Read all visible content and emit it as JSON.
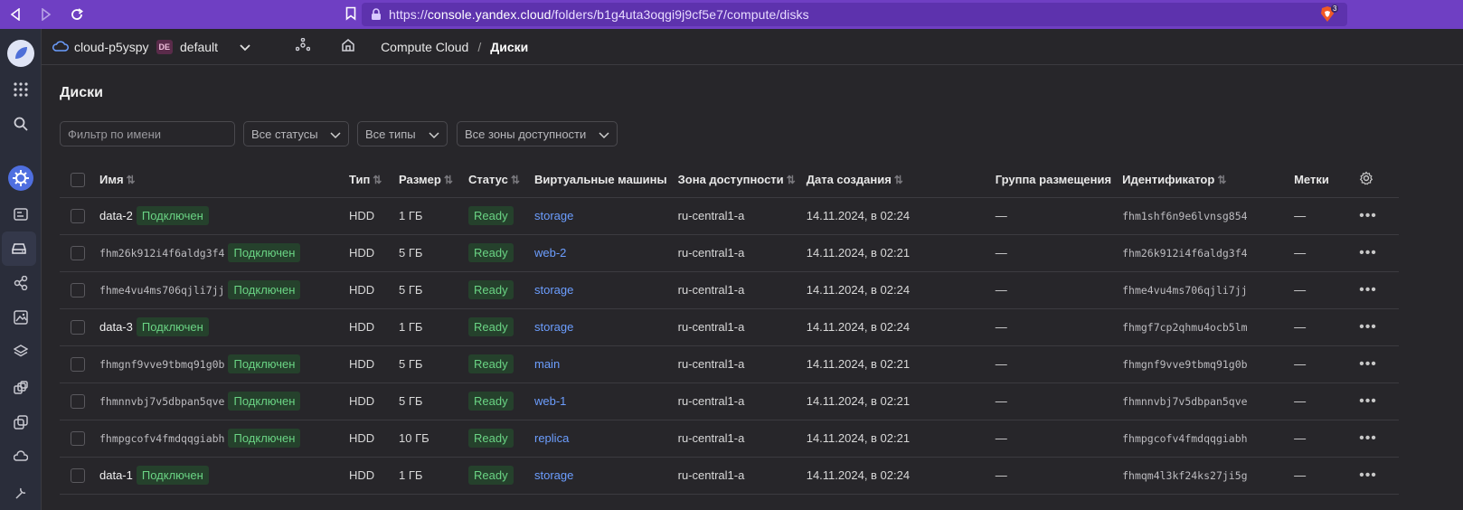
{
  "browser": {
    "url_prefix": "https://",
    "url_host": "console.yandex.cloud",
    "url_path": "/folders/b1g4uta3oqgi9j9cf5e7/compute/disks",
    "brave_badge": "3"
  },
  "topbar": {
    "cloud": "cloud-p5yspy",
    "folder_badge": "DE",
    "folder": "default",
    "breadcrumb_service": "Compute Cloud",
    "breadcrumb_sep": "/",
    "breadcrumb_current": "Диски"
  },
  "page": {
    "title": "Диски",
    "filter_placeholder": "Фильтр по имени",
    "status_select": "Все статусы",
    "type_select": "Все типы",
    "zone_select": "Все зоны доступности"
  },
  "table": {
    "headers": {
      "name": "Имя",
      "type": "Тип",
      "size": "Размер",
      "status": "Статус",
      "vms": "Виртуальные машины",
      "zone": "Зона доступности",
      "created": "Дата создания",
      "group": "Группа размещения",
      "id": "Идентификатор",
      "labels": "Метки"
    },
    "rows": [
      {
        "name": "data-2",
        "mono": false,
        "attached": "Подключен",
        "type": "HDD",
        "size": "1 ГБ",
        "status": "Ready",
        "vm": "storage",
        "zone": "ru-central1-a",
        "created": "14.11.2024, в 02:24",
        "group": "—",
        "id": "fhm1shf6n9e6lvnsg854",
        "labels": "—"
      },
      {
        "name": "fhm26k912i4f6aldg3f4",
        "mono": true,
        "attached": "Подключен",
        "type": "HDD",
        "size": "5 ГБ",
        "status": "Ready",
        "vm": "web-2",
        "zone": "ru-central1-a",
        "created": "14.11.2024, в 02:21",
        "group": "—",
        "id": "fhm26k912i4f6aldg3f4",
        "labels": "—"
      },
      {
        "name": "fhme4vu4ms706qjli7jj",
        "mono": true,
        "attached": "Подключен",
        "type": "HDD",
        "size": "5 ГБ",
        "status": "Ready",
        "vm": "storage",
        "zone": "ru-central1-a",
        "created": "14.11.2024, в 02:24",
        "group": "—",
        "id": "fhme4vu4ms706qjli7jj",
        "labels": "—"
      },
      {
        "name": "data-3",
        "mono": false,
        "attached": "Подключен",
        "type": "HDD",
        "size": "1 ГБ",
        "status": "Ready",
        "vm": "storage",
        "zone": "ru-central1-a",
        "created": "14.11.2024, в 02:24",
        "group": "—",
        "id": "fhmgf7cp2qhmu4ocb5lm",
        "labels": "—"
      },
      {
        "name": "fhmgnf9vve9tbmq91g0b",
        "mono": true,
        "attached": "Подключен",
        "type": "HDD",
        "size": "5 ГБ",
        "status": "Ready",
        "vm": "main",
        "zone": "ru-central1-a",
        "created": "14.11.2024, в 02:21",
        "group": "—",
        "id": "fhmgnf9vve9tbmq91g0b",
        "labels": "—"
      },
      {
        "name": "fhmnnvbj7v5dbpan5qve",
        "mono": true,
        "attached": "Подключен",
        "type": "HDD",
        "size": "5 ГБ",
        "status": "Ready",
        "vm": "web-1",
        "zone": "ru-central1-a",
        "created": "14.11.2024, в 02:21",
        "group": "—",
        "id": "fhmnnvbj7v5dbpan5qve",
        "labels": "—"
      },
      {
        "name": "fhmpgcofv4fmdqqgiabh",
        "mono": true,
        "attached": "Подключен",
        "type": "HDD",
        "size": "10 ГБ",
        "status": "Ready",
        "vm": "replica",
        "zone": "ru-central1-a",
        "created": "14.11.2024, в 02:21",
        "group": "—",
        "id": "fhmpgcofv4fmdqqgiabh",
        "labels": "—"
      },
      {
        "name": "data-1",
        "mono": false,
        "attached": "Подключен",
        "type": "HDD",
        "size": "1 ГБ",
        "status": "Ready",
        "vm": "storage",
        "zone": "ru-central1-a",
        "created": "14.11.2024, в 02:24",
        "group": "—",
        "id": "fhmqm4l3kf24ks27ji5g",
        "labels": "—"
      }
    ]
  },
  "colors": {
    "browser_bar": "#6f3fc3",
    "accent_link": "#6c9eff",
    "status_green": "#6ad484",
    "background": "#27262a"
  }
}
